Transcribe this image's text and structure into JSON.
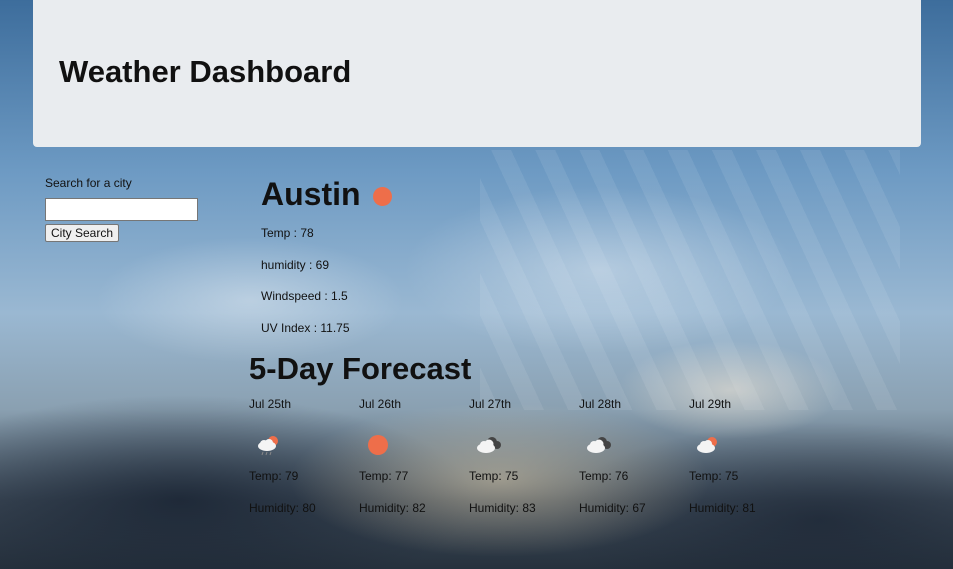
{
  "header": {
    "title": "Weather Dashboard"
  },
  "search": {
    "label": "Search for a city",
    "input_value": "",
    "button_label": "City Search"
  },
  "current": {
    "city": "Austin",
    "icon": "clear-sky-sun-icon",
    "temp": "Temp : 78",
    "humidity": "humidity : 69",
    "windspeed": "Windspeed : 1.5",
    "uv_index": "UV Index : 11.75"
  },
  "forecast": {
    "title": "5-Day Forecast",
    "days": [
      {
        "date": "Jul 25th",
        "icon": "rain-cloud-sun-icon",
        "temp": "Temp: 79",
        "humidity": "Humidity: 80"
      },
      {
        "date": "Jul 26th",
        "icon": "clear-sky-sun-icon",
        "temp": "Temp: 77",
        "humidity": "Humidity: 82"
      },
      {
        "date": "Jul 27th",
        "icon": "broken-clouds-icon",
        "temp": "Temp: 75",
        "humidity": "Humidity: 83"
      },
      {
        "date": "Jul 28th",
        "icon": "broken-clouds-icon",
        "temp": "Temp: 76",
        "humidity": "Humidity: 67"
      },
      {
        "date": "Jul 29th",
        "icon": "few-clouds-sun-icon",
        "temp": "Temp: 75",
        "humidity": "Humidity: 81"
      }
    ]
  },
  "colors": {
    "header_bg": "#e9ecef",
    "sun": "#ee6e4a"
  }
}
